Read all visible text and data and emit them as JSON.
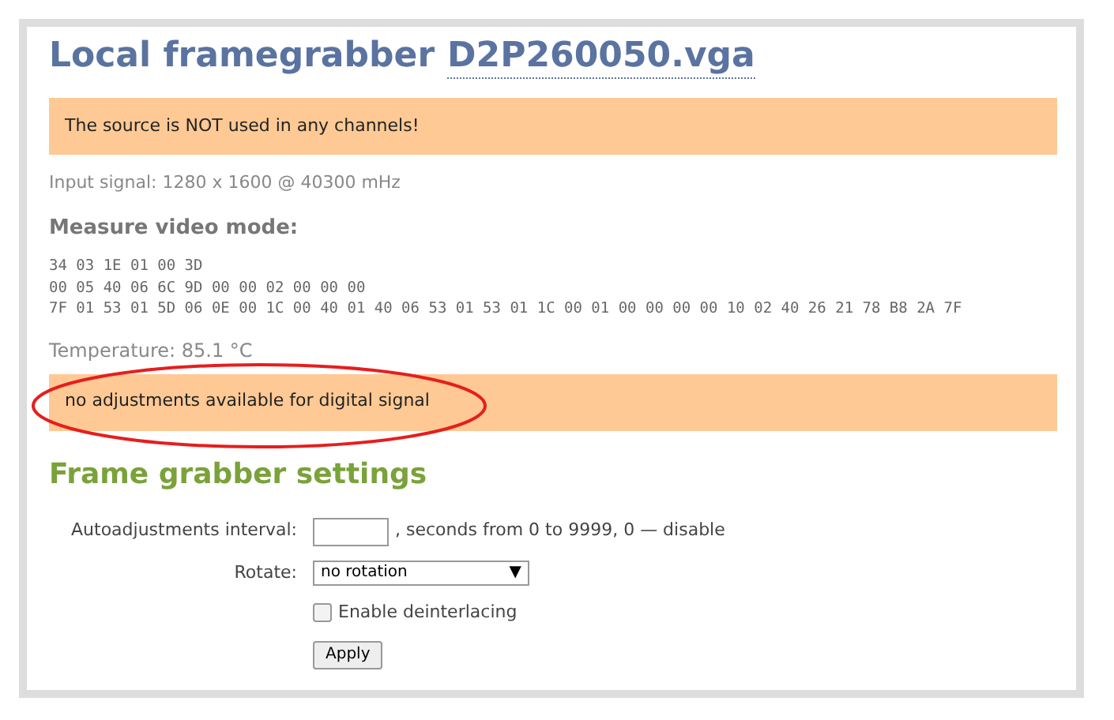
{
  "title": {
    "prefix": "Local framegrabber",
    "name": "D2P260050.vga"
  },
  "notices": [
    {
      "text": "The source is NOT used in any channels!"
    }
  ],
  "input_signal": "Input signal: 1280 x 1600 @ 40300 mHz",
  "measure_heading": "Measure video mode:",
  "hex_lines": [
    "34 03 1E 01 00 3D",
    "00 05 40 06 6C 9D 00 00 02 00 00 00",
    "7F 01 53 01 5D 06 0E 00 1C 00 40 01 40 06 53 01 53 01 1C 00 01 00 00 00 00 10 02 40 26 21 78 B8 2A 7F"
  ],
  "temperature": "Temperature: 85.1 °C",
  "adjust_notice": "no adjustments available for digital signal",
  "settings": {
    "heading": "Frame grabber settings",
    "autoadjust": {
      "label": "Autoadjustments interval:",
      "hint": ", seconds from 0 to 9999, 0 — disable"
    },
    "rotate": {
      "label": "Rotate:",
      "value": "no rotation",
      "arrow": "▼"
    },
    "deinterlacing": {
      "label": "Enable deinterlacing",
      "checked": false
    },
    "apply": "Apply"
  }
}
